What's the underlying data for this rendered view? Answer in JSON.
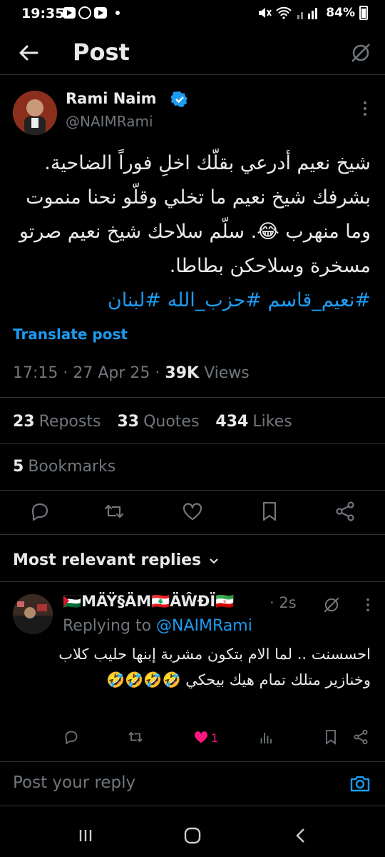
{
  "status_bar": {
    "time": "19:35",
    "battery": "84%"
  },
  "header": {
    "title": "Post"
  },
  "author": {
    "name": "Rami Naim",
    "handle": "@NAIMRami"
  },
  "tweet": {
    "text": "شيخ نعيم أدرعي بقلّك اخلِ فوراً الضاحية. بشرفك شيخ نعيم ما تخلي وقلّو نحنا منموت وما منهرب 😂. سلّم سلاحك شيخ نعيم صرتو مسخرة وسلاحكن بطاطا.",
    "hashtags": "#نعيم_قاسم #حزب_الله #لبنان",
    "translate_label": "Translate post",
    "time": "17:15",
    "date": "27 Apr 25",
    "views_count": "39K",
    "views_label": "Views"
  },
  "stats": {
    "reposts_count": "23",
    "reposts_label": "Reposts",
    "quotes_count": "33",
    "quotes_label": "Quotes",
    "likes_count": "434",
    "likes_label": "Likes",
    "bookmarks_count": "5",
    "bookmarks_label": "Bookmarks"
  },
  "replies_section": {
    "title": "Most relevant replies"
  },
  "reply": {
    "name": "🇵🇸MÄŸ§ÄM🇱🇧ÄŴÐÏ🇮🇷",
    "time": "· 2s",
    "replying_prefix": "Replying to",
    "replying_handle": "@NAIMRami",
    "text": "احسسنت .. لما الام بتكون مشربة إبنها حليب كلاب وخنازير متلك تمام هيك بيحكي 🤣🤣🤣🤣",
    "likes": "1"
  },
  "composer": {
    "placeholder": "Post your reply"
  },
  "colors": {
    "accent": "#1d9bf0",
    "like": "#f91880",
    "muted": "#71767b"
  }
}
